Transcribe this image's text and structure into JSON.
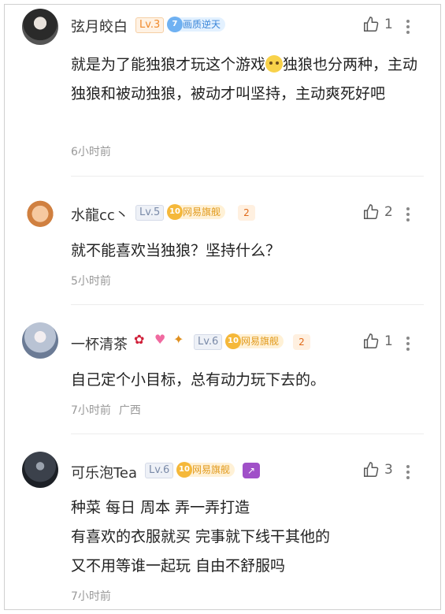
{
  "comments": [
    {
      "username": "弦月皎白",
      "level": "Lv.3",
      "badge": {
        "number": "7",
        "label": "画质逆天"
      },
      "likes": "1",
      "text_before_emoji": "就是为了能独狼才玩这个游戏",
      "text_after_emoji": "独狼也分两种，主动独狼和被动独狼，被动才叫坚持，主动爽死好吧",
      "emoji": "thinking-face-emoji",
      "time": "6小时前",
      "location": ""
    },
    {
      "username": "水龍cc丶",
      "level": "Lv.5",
      "badge": {
        "number": "10",
        "label": "网易旗舰"
      },
      "likes": "2",
      "text": "就不能喜欢当独狼？坚持什么？",
      "time": "5小时前",
      "location": ""
    },
    {
      "username": "一杯清茶",
      "level": "Lv.6",
      "badge": {
        "number": "10",
        "label": "网易旗舰"
      },
      "likes": "1",
      "text": "自己定个小目标，总有动力玩下去的。",
      "time": "7小时前",
      "location": "广西"
    },
    {
      "username": "可乐泡Tea",
      "level": "Lv.6",
      "badge": {
        "number": "10",
        "label": "网易旗舰"
      },
      "likes": "3",
      "lines": [
        "种菜 每日 周本 弄一弄打造",
        "有喜欢的衣服就买 完事就下线干其他的",
        "又不用等谁一起玩 自由不舒服吗"
      ],
      "time": "7小时前",
      "location": ""
    }
  ],
  "icons": {
    "like": "thumbs-up-icon",
    "more": "more-vertical-icon"
  },
  "colors": {
    "level_blue": "#7a8aa8",
    "level_orange": "#f08a2c",
    "vip_gold": "#e19a1c",
    "vip_blue": "#3b86d8",
    "meta_gray": "#999999"
  }
}
